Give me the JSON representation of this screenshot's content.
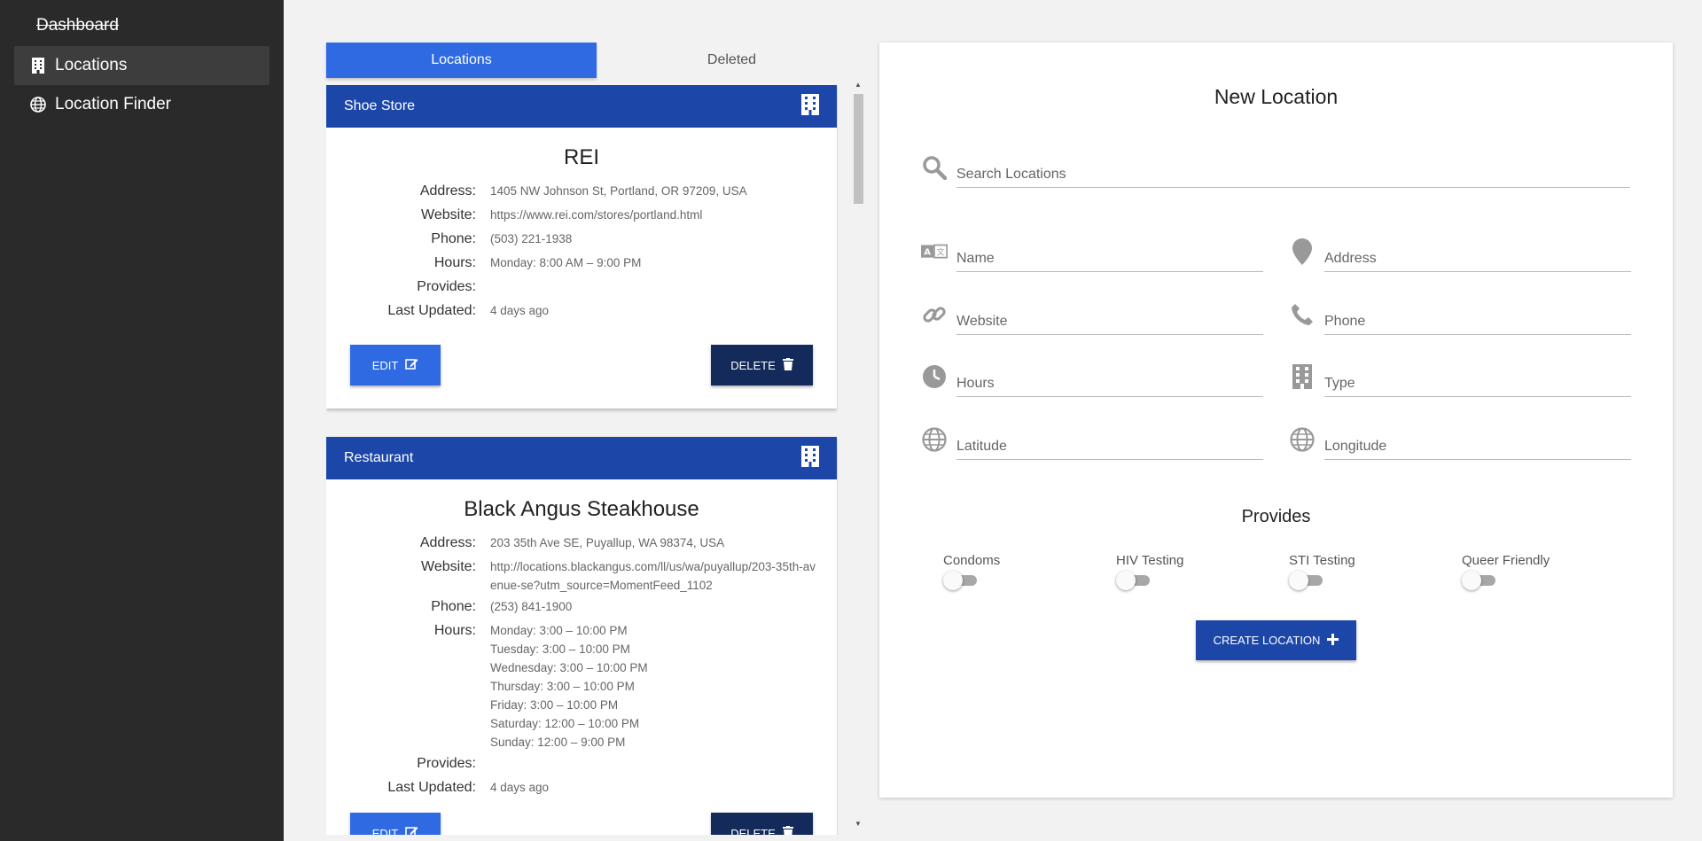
{
  "sidebar": {
    "dashboard_label": "Dashboard",
    "items": [
      {
        "label": "Locations",
        "icon": "building-icon",
        "active": true
      },
      {
        "label": "Location Finder",
        "icon": "globe-icon",
        "active": false
      }
    ]
  },
  "tabs": [
    {
      "label": "Locations",
      "active": true
    },
    {
      "label": "Deleted",
      "active": false
    }
  ],
  "labels": {
    "address": "Address:",
    "website": "Website:",
    "phone": "Phone:",
    "hours": "Hours:",
    "provides": "Provides:",
    "last_updated": "Last Updated:",
    "edit": "EDIT",
    "delete": "DELETE"
  },
  "locations": [
    {
      "type": "Shoe Store",
      "name": "REI",
      "address": "1405 NW Johnson St, Portland, OR 97209, USA",
      "website": "https://www.rei.com/stores/portland.html",
      "phone": "(503) 221-1938",
      "hours": [
        "Monday: 8:00 AM – 9:00 PM"
      ],
      "provides": "",
      "last_updated": "4 days ago"
    },
    {
      "type": "Restaurant",
      "name": "Black Angus Steakhouse",
      "address": "203 35th Ave SE, Puyallup, WA 98374, USA",
      "website": "http://locations.blackangus.com/ll/us/wa/puyallup/203-35th-avenue-se?utm_source=MomentFeed_1102",
      "phone": "(253) 841-1900",
      "hours": [
        "Monday: 3:00 – 10:00 PM",
        "Tuesday: 3:00 – 10:00 PM",
        "Wednesday: 3:00 – 10:00 PM",
        "Thursday: 3:00 – 10:00 PM",
        "Friday: 3:00 – 10:00 PM",
        "Saturday: 12:00 – 10:00 PM",
        "Sunday: 12:00 – 9:00 PM"
      ],
      "provides": "",
      "last_updated": "4 days ago"
    }
  ],
  "new_location": {
    "title": "New Location",
    "search_placeholder": "Search Locations",
    "fields": {
      "name": "Name",
      "address": "Address",
      "website": "Website",
      "phone": "Phone",
      "hours": "Hours",
      "type": "Type",
      "latitude": "Latitude",
      "longitude": "Longitude"
    },
    "provides_title": "Provides",
    "toggles": [
      {
        "label": "Condoms",
        "on": false
      },
      {
        "label": "HIV Testing",
        "on": false
      },
      {
        "label": "STI Testing",
        "on": false
      },
      {
        "label": "Queer Friendly",
        "on": false
      }
    ],
    "create_label": "CREATE LOCATION"
  },
  "colors": {
    "sidebar_bg": "#2a2a2a",
    "primary": "#2f6ae3",
    "card_header": "#1c47a8",
    "delete_button": "#142a5a"
  }
}
